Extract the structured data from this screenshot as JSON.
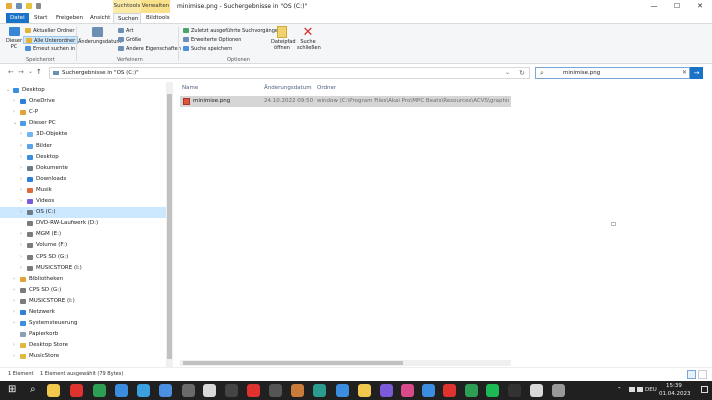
{
  "window": {
    "title": "minimise.png - Suchergebnisse in \"OS (C:)\"",
    "context_tab_search": "Suchtools",
    "context_tab_manage": "Verwalten",
    "minimize": "—",
    "maximize": "☐",
    "close": "✕"
  },
  "ribbon_tabs": [
    "Datei",
    "Start",
    "Freigeben",
    "Ansicht",
    "Suchen",
    "Bildtools"
  ],
  "ribbon": {
    "this_pc": "Dieser PC",
    "current_folder": "Aktueller Ordner",
    "all_subfolders": "Alle Unterordner",
    "search_again": "Erneut suchen in",
    "group_location": "Speicherort",
    "date_modified": "Änderungsdatum",
    "type": "Art",
    "size": "Größe",
    "other_properties": "Andere Eigenschaften",
    "group_refine": "Verfeinern",
    "recent_searches": "Zuletzt ausgeführte Suchvorgänge",
    "advanced_options": "Erweiterte Optionen",
    "save_search": "Suche speichern",
    "group_options": "Optionen",
    "open_location": "Dateipfad öffnen",
    "close_search": "Suche schließen"
  },
  "addressbar": {
    "back": "←",
    "forward": "→",
    "recent": "⌄",
    "up": "↑",
    "path": "Suchergebnisse in \"OS (C:)\"",
    "dropdown": "⌄",
    "refresh": "↻",
    "search_value": "minimise.png",
    "clear": "✕",
    "go": "→"
  },
  "nav": {
    "items": [
      {
        "label": "Desktop",
        "indent": 0,
        "chev": "⌄",
        "color": "#3b8de0"
      },
      {
        "label": "OneDrive",
        "indent": 1,
        "chev": "›",
        "color": "#2f7fd9"
      },
      {
        "label": "C-P",
        "indent": 1,
        "chev": "›",
        "color": "#e0a33a"
      },
      {
        "label": "Dieser PC",
        "indent": 1,
        "chev": "⌄",
        "color": "#4c9be6"
      },
      {
        "label": "3D-Objekte",
        "indent": 2,
        "chev": "›",
        "color": "#6fb6f0"
      },
      {
        "label": "Bilder",
        "indent": 2,
        "chev": "›",
        "color": "#5aa3e8"
      },
      {
        "label": "Desktop",
        "indent": 2,
        "chev": "›",
        "color": "#3b8de0"
      },
      {
        "label": "Dokumente",
        "indent": 2,
        "chev": "›",
        "color": "#6d7a88"
      },
      {
        "label": "Downloads",
        "indent": 2,
        "chev": "›",
        "color": "#2f7fd9"
      },
      {
        "label": "Musik",
        "indent": 2,
        "chev": "›",
        "color": "#e06b3a"
      },
      {
        "label": "Videos",
        "indent": 2,
        "chev": "›",
        "color": "#7a5ad9"
      },
      {
        "label": "OS (C:)",
        "indent": 2,
        "chev": "›",
        "color": "#6d7a88"
      },
      {
        "label": "DVD-RW-Laufwerk (D:)",
        "indent": 2,
        "chev": "",
        "color": "#7b7b7b"
      },
      {
        "label": "MGM (E:)",
        "indent": 2,
        "chev": "›",
        "color": "#7b7b7b"
      },
      {
        "label": "Volume (F:)",
        "indent": 2,
        "chev": "›",
        "color": "#7b7b7b"
      },
      {
        "label": "CPS SD (G:)",
        "indent": 2,
        "chev": "›",
        "color": "#7b7b7b"
      },
      {
        "label": "MUSICSTORE (I:)",
        "indent": 2,
        "chev": "›",
        "color": "#7b7b7b"
      },
      {
        "label": "Bibliotheken",
        "indent": 1,
        "chev": "›",
        "color": "#e0a33a"
      },
      {
        "label": "CPS SD (G:)",
        "indent": 1,
        "chev": "›",
        "color": "#7b7b7b"
      },
      {
        "label": "MUSICSTORE (I:)",
        "indent": 1,
        "chev": "›",
        "color": "#7b7b7b"
      },
      {
        "label": "Netzwerk",
        "indent": 1,
        "chev": "›",
        "color": "#2f7fd9"
      },
      {
        "label": "Systemsteuerung",
        "indent": 1,
        "chev": "›",
        "color": "#3b8de0"
      },
      {
        "label": "Papierkorb",
        "indent": 1,
        "chev": "",
        "color": "#8aa0b4"
      },
      {
        "label": "Desktop Store",
        "indent": 1,
        "chev": "›",
        "color": "#e0b83a"
      },
      {
        "label": "MusicStore",
        "indent": 1,
        "chev": "›",
        "color": "#e0b83a"
      }
    ],
    "selected": 11
  },
  "content": {
    "columns": {
      "name": "Name",
      "date": "Änderungsdatum",
      "folder": "Ordner"
    },
    "rows": [
      {
        "name": "minimise.png",
        "date": "24.10.2022 09:50",
        "folder": "window (C:\\Program Files\\Akai Pro\\MPC Beats\\Resources\\ACVS\\graphics)"
      }
    ]
  },
  "status": {
    "count": "1 Element",
    "selected": "1 Element ausgewählt (79 Bytes)"
  },
  "taskbar": {
    "start": "⊞",
    "search": "⌕",
    "apps": [
      "#f2c94c",
      "#e0332f",
      "#2e9e54",
      "#3b8de0",
      "#3aa0e0",
      "#4a8fe0",
      "#6a6a6a",
      "#d9d9d9",
      "#444",
      "#e0332f",
      "#555",
      "#c97b3a",
      "#2a9d8f",
      "#3b8de0",
      "#f2c94c",
      "#7a5ad9",
      "#d94a8a",
      "#3b8de0",
      "#e0332f",
      "#2e9e54",
      "#1db954",
      "#333",
      "#d9d9d9",
      "#999"
    ],
    "tray_chevron": "⌃",
    "language": "DEU",
    "time": "15:39",
    "date": "01.04.2023"
  }
}
